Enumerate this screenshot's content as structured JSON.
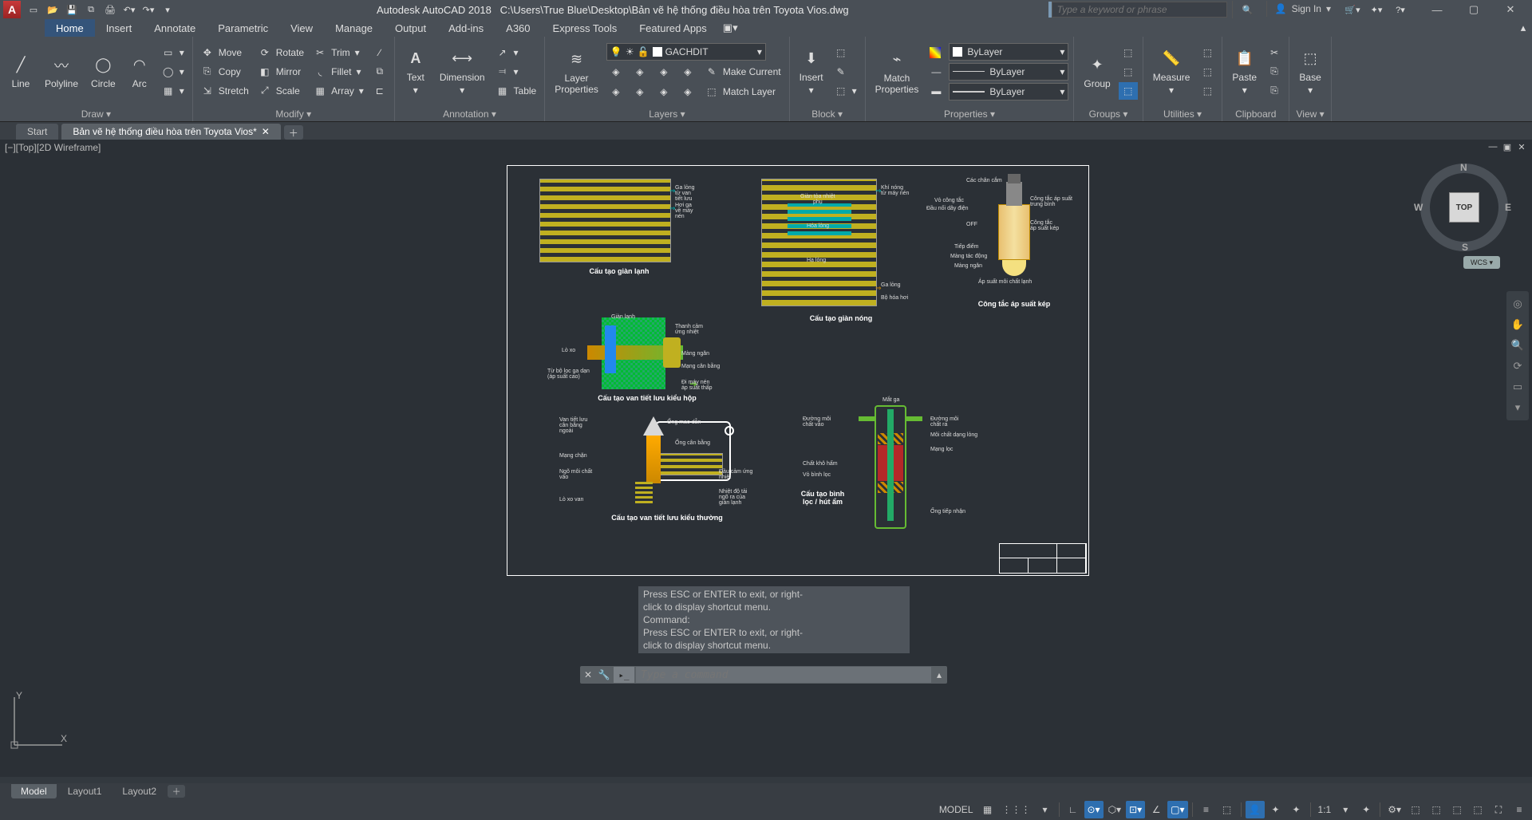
{
  "title": {
    "app": "Autodesk AutoCAD 2018",
    "path": "C:\\Users\\True Blue\\Desktop\\Bản vẽ hệ thống điều hòa trên Toyota Vios.dwg"
  },
  "search": {
    "placeholder": "Type a keyword or phrase"
  },
  "signin": "Sign In",
  "tabs": [
    "Home",
    "Insert",
    "Annotate",
    "Parametric",
    "View",
    "Manage",
    "Output",
    "Add-ins",
    "A360",
    "Express Tools",
    "Featured Apps"
  ],
  "ribbon": {
    "draw": {
      "title": "Draw ▾",
      "line": "Line",
      "polyline": "Polyline",
      "circle": "Circle",
      "arc": "Arc"
    },
    "modify": {
      "title": "Modify ▾",
      "move": "Move",
      "rotate": "Rotate",
      "trim": "Trim",
      "copy": "Copy",
      "mirror": "Mirror",
      "fillet": "Fillet",
      "stretch": "Stretch",
      "scale": "Scale",
      "array": "Array"
    },
    "annotation": {
      "title": "Annotation ▾",
      "text": "Text",
      "dimension": "Dimension",
      "table": "Table"
    },
    "layers": {
      "title": "Layers ▾",
      "properties": "Layer\nProperties",
      "current": "GACHDIT",
      "make_current": "Make Current",
      "match": "Match Layer"
    },
    "block": {
      "title": "Block ▾",
      "insert": "Insert"
    },
    "properties": {
      "title": "Properties ▾",
      "match": "Match\nProperties",
      "bylayer": "ByLayer"
    },
    "groups": {
      "title": "Groups ▾",
      "group": "Group"
    },
    "utilities": {
      "title": "Utilities ▾",
      "measure": "Measure"
    },
    "clipboard": {
      "title": "Clipboard",
      "paste": "Paste"
    },
    "view": {
      "title": "View ▾",
      "base": "Base"
    }
  },
  "file_tabs": {
    "start": "Start",
    "active": "Bản vẽ hệ thống điều hòa trên Toyota Vios*"
  },
  "viewport": "[−][Top][2D Wireframe]",
  "viewcube": {
    "face": "TOP",
    "n": "N",
    "s": "S",
    "e": "E",
    "w": "W",
    "wcs": "WCS ▾"
  },
  "drawing": {
    "cap1": "Cấu tạo giàn lạnh",
    "cap2": "Cấu tạo giàn nóng",
    "cap3": "Công tắc áp suất kép",
    "cap4": "Cấu tạo van tiết lưu kiểu hộp",
    "cap5": "Cấu tạo van tiết lưu kiểu thường",
    "cap6": "Cấu tạo bình\nlọc / hút ẩm",
    "labels_evap": {
      "a": "Ga lỏng\ntừ van tiết lưu",
      "b": "Hơi ga\nvề máy nén"
    },
    "labels_cond": {
      "a": "Khí nóng\ntừ máy nén",
      "b": "Ga lỏng",
      "c": "Bộ hóa hơi",
      "d": "Giàn tỏa nhiệt\nphụ",
      "e": "Hóa lỏng",
      "f": "Hạ lỏng"
    },
    "labels_switch": {
      "a": "Các chân cắm",
      "b": "Vỏ công tắc",
      "c": "Đầu nối dây điện",
      "d": "Công tắc áp suất\ntrung bình",
      "e": "Công tắc\náp suất kép",
      "f": "Tiếp điểm",
      "g": "Màng tác động",
      "h": "Màng ngăn",
      "i": "Áp suất môi chất lạnh",
      "j": "OFF"
    },
    "labels_valve1": {
      "a": "Giàn lạnh",
      "b": "Lò xo",
      "c": "Từ bộ lọc ga dạn\n(áp suất cao)",
      "d": "Thanh cảm\nứng nhiệt",
      "e": "Màng ngăn",
      "f": "Mạng cân bằng",
      "g": "Đi máy nén\náp suất thấp"
    },
    "labels_valve2": {
      "a": "Van tiết lưu\ncân bằng\nngoài",
      "b": "Mạng chặn",
      "c": "Lò xo van",
      "d": "Ống mao dẫn",
      "e": "Ngõ môi chất\nvào",
      "f": "Ống cân bằng",
      "g": "Đầu cảm ứng\nnhiệt",
      "h": "Nhiệt độ tải\nngõ ra của\ngiàn lạnh"
    },
    "labels_dryer": {
      "a": "Mắt ga",
      "b": "Đường môi\nchất vào",
      "c": "Đường môi\nchất ra",
      "d": "Môi chất dạng lỏng",
      "e": "Mạng lọc",
      "f": "Chất khô hấm",
      "g": "Vỏ bình lọc",
      "h": "Ống tiếp nhận"
    }
  },
  "cmd": {
    "history": [
      "Press ESC or ENTER to exit, or right-",
      "click to display shortcut menu.",
      "Command:",
      "Press ESC or ENTER to exit, or right-",
      "click to display shortcut menu."
    ],
    "placeholder": "Type a command"
  },
  "layout_tabs": [
    "Model",
    "Layout1",
    "Layout2"
  ],
  "statusbar": {
    "model": "MODEL",
    "scale": "1:1"
  }
}
